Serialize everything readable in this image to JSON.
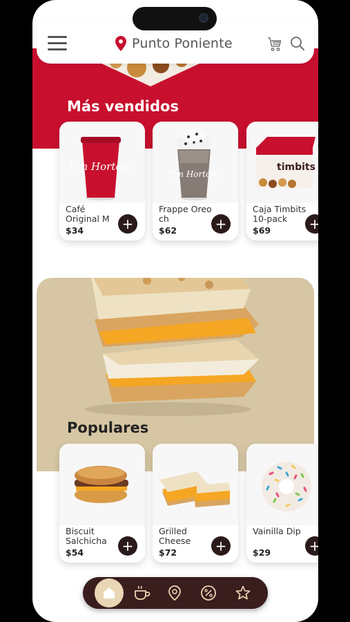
{
  "header": {
    "location": "Punto Poniente"
  },
  "sections": {
    "best_sellers_title": "Más vendidos",
    "popular_title": "Populares"
  },
  "best_sellers": [
    {
      "name": "Café Original M",
      "price": "$34"
    },
    {
      "name": "Frappe Oreo ch",
      "price": "$62"
    },
    {
      "name": "Caja Timbits 10-pack",
      "price": "$69"
    }
  ],
  "popular": [
    {
      "name": "Biscuit Salchicha",
      "price": "$54"
    },
    {
      "name": "Grilled Cheese",
      "price": "$72"
    },
    {
      "name": "Vainilla Dip",
      "price": "$29"
    }
  ],
  "cup_logo": "Tim Hortons",
  "box_logo": "timbits",
  "add_symbol": "+",
  "nav": [
    "home",
    "coffee",
    "location",
    "promotions",
    "favorites"
  ],
  "colors": {
    "brand_red": "#c8102e",
    "dark_brown": "#3a1e1e",
    "promo_tan": "#d6c6a3",
    "nav_active": "#e8d6b4"
  }
}
